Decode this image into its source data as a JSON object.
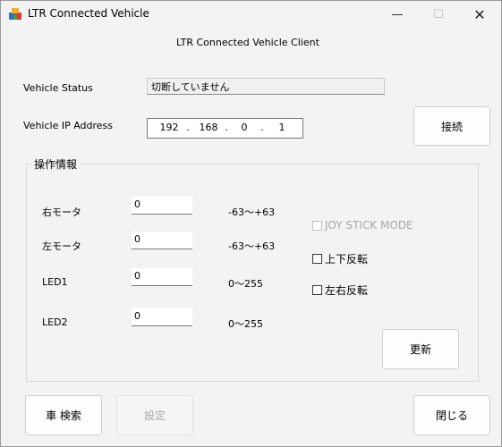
{
  "window": {
    "title": "LTR Connected Vehicle",
    "minimize_glyph": "—",
    "maximize_glyph": "☐",
    "close_glyph": "✕"
  },
  "header": {
    "heading": "LTR Connected Vehicle Client"
  },
  "status": {
    "label": "Vehicle Status",
    "value": "切断していません"
  },
  "ip": {
    "label": "Vehicle IP Address",
    "octets": [
      "192",
      "168",
      "0",
      "1"
    ],
    "dot": "."
  },
  "buttons": {
    "connect": "接続",
    "update": "更新",
    "search": "車 検索",
    "settings": "設定",
    "close": "閉じる"
  },
  "group": {
    "title": "操作情報",
    "rows": [
      {
        "label": "右モータ",
        "value": "0",
        "range": "-63～+63"
      },
      {
        "label": "左モータ",
        "value": "0",
        "range": "-63～+63"
      },
      {
        "label": "LED1",
        "value": "0",
        "range": "0～255"
      },
      {
        "label": "LED2",
        "value": "0",
        "range": "0～255"
      }
    ],
    "checkboxes": {
      "joystick": "JOY STICK MODE",
      "updown": "上下反転",
      "leftright": "左右反転"
    }
  },
  "icons": {
    "app": "app-cube-icon"
  }
}
